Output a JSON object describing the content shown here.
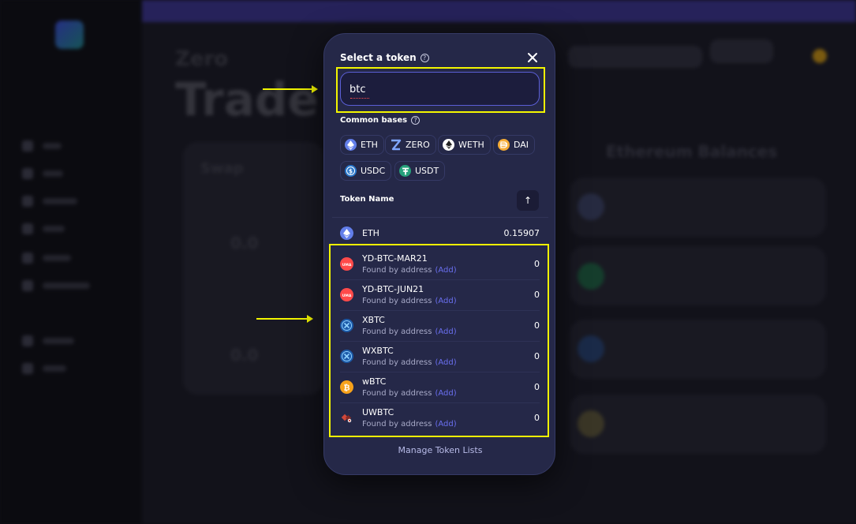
{
  "background": {
    "app_subtitle": "Zero",
    "page_title": "Trade",
    "card_title": "Swap",
    "amount_1": "0.0",
    "amount_2": "0.0",
    "balances_heading": "Ethereum Balances"
  },
  "modal": {
    "title": "Select a token",
    "search": {
      "value": "btc",
      "placeholder": ""
    },
    "common_bases_label": "Common bases",
    "common_bases": [
      {
        "symbol": "ETH",
        "icon": "eth-icon",
        "color": "#627eea"
      },
      {
        "symbol": "ZERO",
        "icon": "zero-icon",
        "color": "#3f6fe0"
      },
      {
        "symbol": "WETH",
        "icon": "weth-icon",
        "color": "#ffffff"
      },
      {
        "symbol": "DAI",
        "icon": "dai-icon",
        "color": "#f5ac37"
      },
      {
        "symbol": "USDC",
        "icon": "usdc-icon",
        "color": "#2775ca"
      },
      {
        "symbol": "USDT",
        "icon": "usdt-icon",
        "color": "#26a17b"
      }
    ],
    "column_header": "Token Name",
    "sort_icon": "arrow-up-icon",
    "default_token": {
      "symbol": "ETH",
      "balance": "0.15907",
      "icon": "eth-icon"
    },
    "found_tokens": [
      {
        "symbol": "YD-BTC-MAR21",
        "note": "Found by address",
        "action": "(Add)",
        "balance": "0",
        "icon": "uma-icon"
      },
      {
        "symbol": "YD-BTC-JUN21",
        "note": "Found by address",
        "action": "(Add)",
        "balance": "0",
        "icon": "uma-icon"
      },
      {
        "symbol": "XBTC",
        "note": "Found by address",
        "action": "(Add)",
        "balance": "0",
        "icon": "xbtc-icon"
      },
      {
        "symbol": "WXBTC",
        "note": "Found by address",
        "action": "(Add)",
        "balance": "0",
        "icon": "xbtc-icon"
      },
      {
        "symbol": "wBTC",
        "note": "Found by address",
        "action": "(Add)",
        "balance": "0",
        "icon": "btc-icon"
      },
      {
        "symbol": "UWBTC",
        "note": "Found by address",
        "action": "(Add)",
        "balance": "0",
        "icon": "unit-icon"
      }
    ],
    "manage_link": "Manage Token Lists"
  },
  "colors": {
    "highlight": "#f3f600",
    "modal_bg": "#252848",
    "accent": "#6a6ff0"
  }
}
